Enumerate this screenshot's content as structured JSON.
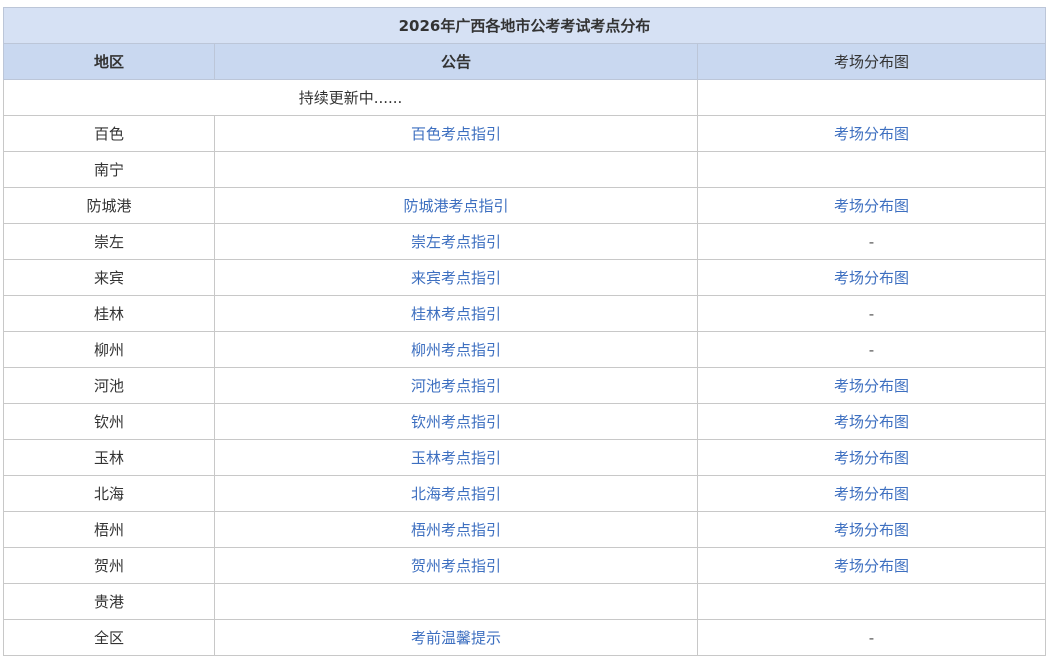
{
  "table": {
    "title": "2026年广西各地市公考考试考点分布",
    "headers": {
      "region": "地区",
      "notice": "公告",
      "map": "考场分布图"
    },
    "note": "持续更新中......",
    "rows": [
      {
        "region": "百色",
        "notice": "百色考点指引",
        "map": "考场分布图"
      },
      {
        "region": "南宁",
        "notice": "",
        "map": ""
      },
      {
        "region": "防城港",
        "notice": "防城港考点指引",
        "map": "考场分布图"
      },
      {
        "region": "崇左",
        "notice": "崇左考点指引",
        "map": "-"
      },
      {
        "region": "来宾",
        "notice": "来宾考点指引",
        "map": "考场分布图"
      },
      {
        "region": "桂林",
        "notice": "桂林考点指引",
        "map": "-"
      },
      {
        "region": "柳州",
        "notice": "柳州考点指引",
        "map": "-"
      },
      {
        "region": "河池",
        "notice": "河池考点指引",
        "map": "考场分布图"
      },
      {
        "region": "钦州",
        "notice": "钦州考点指引",
        "map": "考场分布图"
      },
      {
        "region": "玉林",
        "notice": "玉林考点指引",
        "map": "考场分布图"
      },
      {
        "region": "北海",
        "notice": "北海考点指引",
        "map": "考场分布图"
      },
      {
        "region": "梧州",
        "notice": "梧州考点指引",
        "map": "考场分布图"
      },
      {
        "region": "贺州",
        "notice": "贺州考点指引",
        "map": "考场分布图"
      },
      {
        "region": "贵港",
        "notice": "",
        "map": ""
      },
      {
        "region": "全区",
        "notice": "考前温馨提示",
        "map": "-"
      }
    ]
  }
}
